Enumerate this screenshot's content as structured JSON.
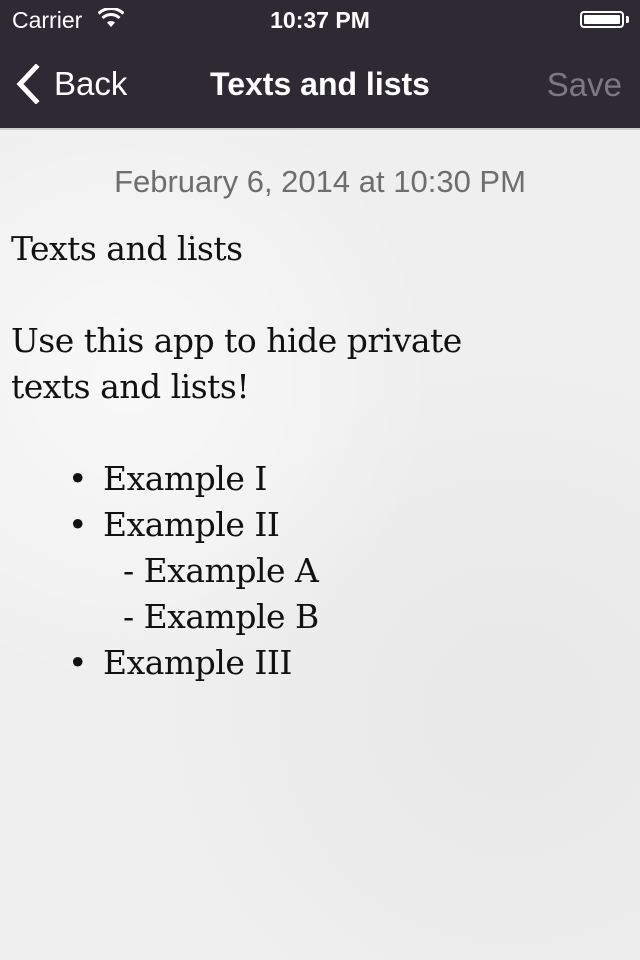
{
  "status_bar": {
    "carrier": "Carrier",
    "time": "10:37 PM",
    "battery_level": 1.0
  },
  "nav": {
    "back_label": "Back",
    "title": "Texts and lists",
    "save_label": "Save"
  },
  "note": {
    "date": "February 6, 2014 at 10:30 PM",
    "heading": "Texts and lists",
    "body_line1": "Use this app to hide private",
    "body_line2": "texts and lists!",
    "list": [
      {
        "marker": "•",
        "text": "Example I"
      },
      {
        "marker": "•",
        "text": "Example II"
      },
      {
        "marker": "-",
        "text": "Example A"
      },
      {
        "marker": "-",
        "text": "Example B"
      },
      {
        "marker": "•",
        "text": "Example III"
      }
    ]
  }
}
